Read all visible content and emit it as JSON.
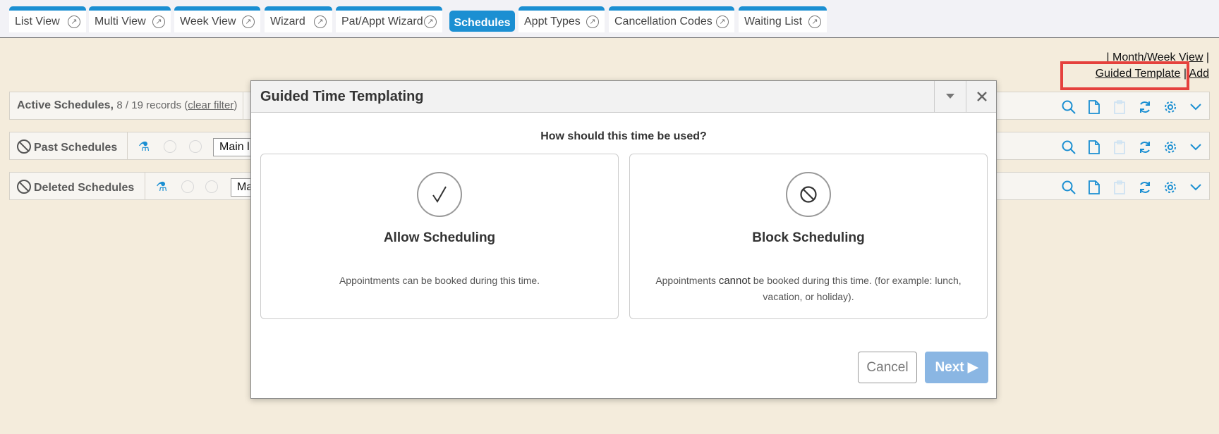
{
  "tabs": [
    {
      "label": "List View"
    },
    {
      "label": "Multi View"
    },
    {
      "label": "Week View"
    },
    {
      "label": "Wizard"
    },
    {
      "label": "Pat/Appt Wizard"
    },
    {
      "label": "Schedules"
    },
    {
      "label": "Appt Types"
    },
    {
      "label": "Cancellation Codes"
    },
    {
      "label": "Waiting List"
    }
  ],
  "toplinks": {
    "pre_sep": "|",
    "month_week": "Month/Week View",
    "sep": "|",
    "guided_template": "Guided Template",
    "add": "Add"
  },
  "rows": {
    "active": {
      "title": "Active Schedules,",
      "count": "8 / 19 records",
      "clear_filter": "clear filter"
    },
    "past": {
      "title": "Past Schedules",
      "select_value": "Main l"
    },
    "deleted": {
      "title": "Deleted Schedules",
      "select_value": "Ma"
    }
  },
  "modal": {
    "title": "Guided Time Templating",
    "question": "How should this time be used?",
    "allow": {
      "title": "Allow Scheduling",
      "desc": "Appointments can be booked during this time."
    },
    "block": {
      "title": "Block Scheduling",
      "desc_pre": "Appointments ",
      "desc_emph": "cannot",
      "desc_post": " be booked during this time. (for example: lunch, vacation, or holiday)."
    },
    "cancel": "Cancel",
    "next": "Next ▶"
  },
  "colors": {
    "accent": "#1b8fd2",
    "highlight": "#e5413d",
    "background": "#f4ecdc"
  }
}
